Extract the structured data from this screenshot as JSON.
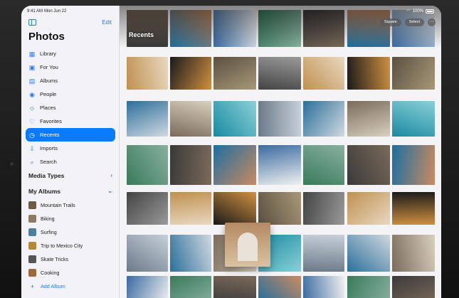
{
  "status": {
    "time": "9:41 AM",
    "date": "Mon Jun 22",
    "battery": "100%"
  },
  "sidebar": {
    "title": "Photos",
    "edit_label": "Edit",
    "items": [
      {
        "label": "Library",
        "icon": "library-icon",
        "glyph": "▦"
      },
      {
        "label": "For You",
        "icon": "for-you-icon",
        "glyph": "▣"
      },
      {
        "label": "Albums",
        "icon": "albums-icon",
        "glyph": "▤"
      },
      {
        "label": "People",
        "icon": "people-icon",
        "glyph": "◉"
      },
      {
        "label": "Places",
        "icon": "places-icon",
        "glyph": "⬦"
      },
      {
        "label": "Favorites",
        "icon": "heart-icon",
        "glyph": "♡"
      },
      {
        "label": "Recents",
        "icon": "clock-icon",
        "glyph": "◷",
        "active": true
      },
      {
        "label": "Imports",
        "icon": "import-icon",
        "glyph": "⇩"
      },
      {
        "label": "Search",
        "icon": "search-icon",
        "glyph": "⌕"
      }
    ],
    "media_types_label": "Media Types",
    "my_albums_label": "My Albums",
    "albums": [
      {
        "label": "Mountain Trails",
        "color": "#6b5a45"
      },
      {
        "label": "Biking",
        "color": "#8a7a66"
      },
      {
        "label": "Surfing",
        "color": "#4f7f9a"
      },
      {
        "label": "Trip to Mexico City",
        "color": "#b0893a"
      },
      {
        "label": "Skate Tricks",
        "color": "#555555"
      },
      {
        "label": "Cooking",
        "color": "#9a6a3a"
      }
    ],
    "add_album_label": "Add Album"
  },
  "main": {
    "title": "Recents",
    "square_label": "Square",
    "select_label": "Select",
    "more_glyph": "···"
  },
  "colors": {
    "accent": "#0a7aff"
  }
}
